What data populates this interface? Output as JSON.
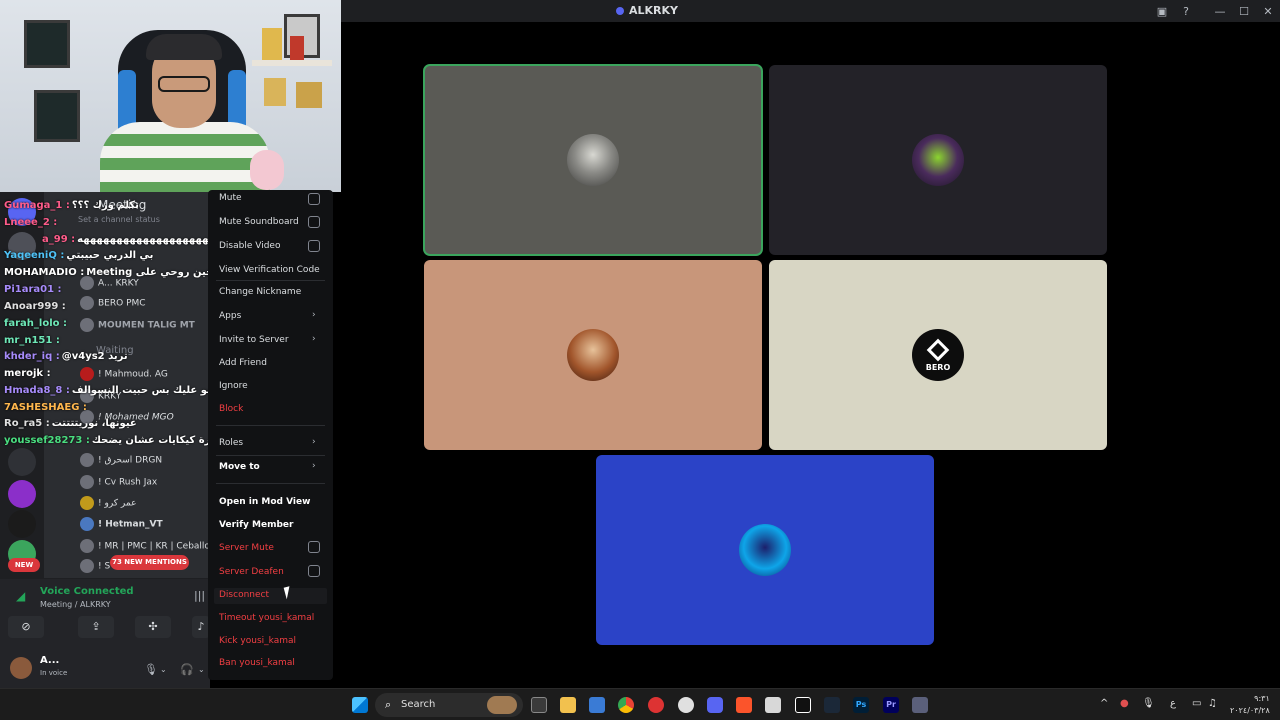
{
  "window": {
    "title": "ALKRKY"
  },
  "titlebar_icons": [
    "screen-share-icon",
    "help-icon",
    "minimize-icon",
    "maximize-icon",
    "close-icon"
  ],
  "stage": {
    "tiles": [
      {
        "name": "participant-1",
        "color": "#5a5a55",
        "speaking": true
      },
      {
        "name": "participant-2",
        "color": "#232228"
      },
      {
        "name": "participant-3",
        "color": "#c8967a"
      },
      {
        "name": "participant-4",
        "color": "#d8d6c4",
        "avatar_text": "BERO"
      },
      {
        "name": "participant-5",
        "color": "#2b43c7"
      }
    ]
  },
  "sidebar": {
    "channel_name": "Meeting",
    "channel_status": "Set a channel status",
    "waiting_label": "waiting",
    "waiting_label_2": "Waiting",
    "voice_members": [
      {
        "name": "A...",
        "tag": "KRKY"
      },
      {
        "name": "BERO",
        "tag": "PMC"
      },
      {
        "name": "MOUMEN TALIG",
        "tag": "MT"
      },
      {
        "name": "! Mahmoud.",
        "tag": "AG"
      },
      {
        "name": "KRKY",
        "tag": ""
      },
      {
        "name": "! Mohamed",
        "tag": "MGO"
      },
      {
        "name": "! اسحرق",
        "tag": "DRGN"
      },
      {
        "name": "! Cv Rush",
        "tag": "Jax"
      },
      {
        "name": "! عمر كرو",
        "tag": ""
      },
      {
        "name": "! Hetman_VT",
        "tag": ""
      },
      {
        "name": "! MR | PMC | KR | Ceballos...",
        "tag": ""
      },
      {
        "name": "! S",
        "tag": ""
      }
    ],
    "new_badge": "NEW",
    "mentions_badge": "73 NEW MENTIONS"
  },
  "chat_overlay": [
    {
      "user": "Gumaga_1 :",
      "msg": "تكلم وزك ؟؟؟",
      "color": "#ff5c8a"
    },
    {
      "user": "Lneee_2 :",
      "msg": "",
      "color": "#ff5c8a"
    },
    {
      "user": "a_99 :",
      "msg": "هههههههههههههههههههههههههههه",
      "color": "#ff5c8a"
    },
    {
      "user": "YaqeeniQ :",
      "msg": "بي الدربي حبيبتي",
      "color": "#4fc3f7"
    },
    {
      "user": "MOHAMADIO :",
      "msg": "Meeting لا كريدين تصحين روحي على",
      "color": "#ffffff"
    },
    {
      "user": "Pi1ara01 :",
      "msg": "",
      "color": "#a78bfa"
    },
    {
      "user": "Anoar999 :",
      "msg": "",
      "color": "#e0e0e0"
    },
    {
      "user": "farah_lolo :",
      "msg": "",
      "color": "#6ee7b7"
    },
    {
      "user": "mr_n151 :",
      "msg": "",
      "color": "#6ee7b7"
    },
    {
      "user": "khder_iq :",
      "msg": "@v4ys2 تريد",
      "color": "#a78bfa"
    },
    {
      "user": "merojk :",
      "msg": "",
      "color": "#ffffff"
    },
    {
      "user": "Hmada8_8 :",
      "msg": "لا مو عليك بس حبيت النسوالف",
      "color": "#a78bfa"
    },
    {
      "user": "7ASHESHAEG :",
      "msg": "",
      "color": "#ffb74d"
    },
    {
      "user": "Ro_ra5 :",
      "msg": "عيونها، نوريتتتتت",
      "color": "#e0e0e0"
    },
    {
      "user": "youssef28273 :",
      "msg": "اقفي عشرة كيكايات عشان يضحك",
      "color": "#4ade80"
    }
  ],
  "voice_panel": {
    "title": "Voice Connected",
    "subtitle": "Meeting / ALKRKY",
    "user_name": "A...",
    "user_status": "In voice"
  },
  "context_menu": {
    "items": [
      {
        "label": "Mute",
        "type": "checkbox"
      },
      {
        "label": "Mute Soundboard",
        "type": "checkbox"
      },
      {
        "label": "Disable Video",
        "type": "checkbox"
      },
      {
        "label": "View Verification Code",
        "type": "item"
      },
      {
        "label": "Change Nickname",
        "type": "item"
      },
      {
        "label": "Apps",
        "type": "submenu"
      },
      {
        "label": "Invite to Server",
        "type": "submenu"
      },
      {
        "label": "Add Friend",
        "type": "item"
      },
      {
        "label": "Ignore",
        "type": "item"
      },
      {
        "label": "Block",
        "type": "danger"
      },
      {
        "label": "Roles",
        "type": "submenu"
      },
      {
        "label": "Move to",
        "type": "submenu"
      },
      {
        "label": "Open in Mod View",
        "type": "bold"
      },
      {
        "label": "Verify Member",
        "type": "bold"
      },
      {
        "label": "Server Mute",
        "type": "danger-checkbox"
      },
      {
        "label": "Server Deafen",
        "type": "danger-checkbox"
      },
      {
        "label": "Disconnect",
        "type": "danger"
      },
      {
        "label": "Timeout yousi_kamal",
        "type": "danger"
      },
      {
        "label": "Kick yousi_kamal",
        "type": "danger"
      },
      {
        "label": "Ban yousi_kamal",
        "type": "danger"
      }
    ]
  },
  "taskbar": {
    "search_label": "Search",
    "apps": [
      "start-icon",
      "search-icon",
      "task-view-icon",
      "file-explorer-icon",
      "store-icon",
      "chrome-icon",
      "settings-icon",
      "steam-link-icon",
      "discord-icon",
      "brave-icon",
      "media-icon",
      "capcut-icon",
      "steam-icon",
      "photoshop-icon",
      "premiere-icon",
      "app-icon"
    ],
    "tray_lang": "ع",
    "clock_time": "٩:٣١",
    "clock_date": "٢٠٢٤/٠٣/٢٨"
  }
}
